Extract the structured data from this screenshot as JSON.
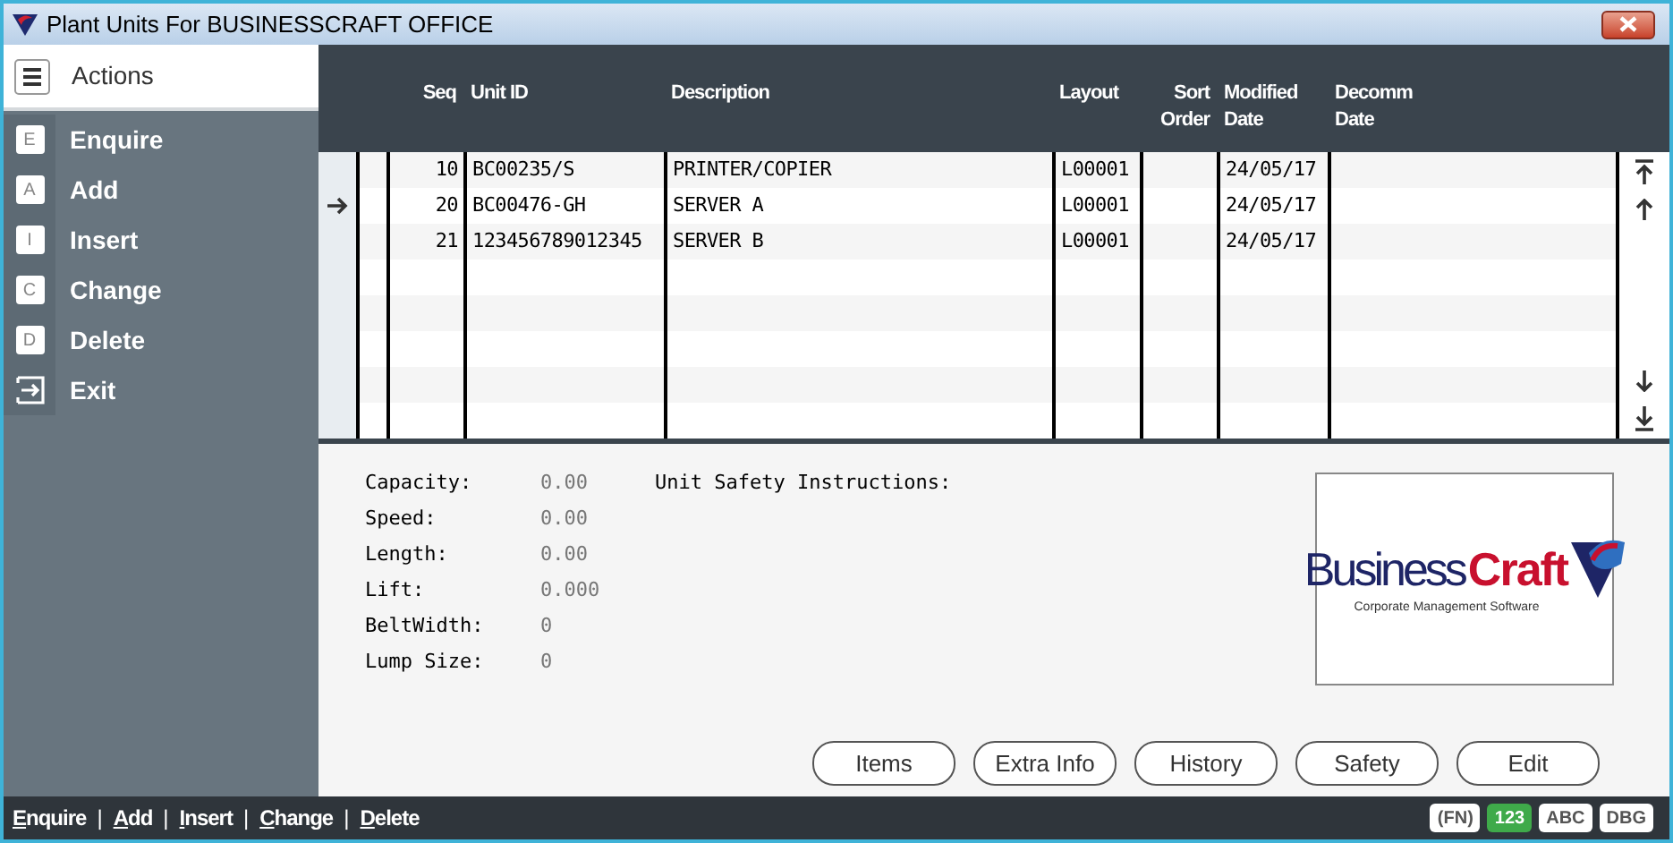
{
  "window": {
    "title": "Plant Units For BUSINESSCRAFT OFFICE"
  },
  "sidebar": {
    "title": "Actions",
    "items": [
      {
        "kind": "key",
        "key": "E",
        "label": "Enquire"
      },
      {
        "kind": "key",
        "key": "A",
        "label": "Add"
      },
      {
        "kind": "key",
        "key": "I",
        "label": "Insert"
      },
      {
        "kind": "key",
        "key": "C",
        "label": "Change"
      },
      {
        "kind": "key",
        "key": "D",
        "label": "Delete"
      },
      {
        "kind": "exit",
        "label": "Exit"
      }
    ]
  },
  "table": {
    "columns": [
      {
        "label": "Seq"
      },
      {
        "label": "Unit ID"
      },
      {
        "label": "Description"
      },
      {
        "label": "Layout"
      },
      {
        "label": "Sort Order"
      },
      {
        "label": "Modified Date"
      },
      {
        "label": "Decomm Date"
      }
    ],
    "rows": [
      {
        "selected": false,
        "cells": [
          "10",
          "BC00235/S",
          "PRINTER/COPIER",
          "L00001",
          "",
          "24/05/17",
          ""
        ]
      },
      {
        "selected": true,
        "cells": [
          "20",
          "BC00476-GH",
          "SERVER A",
          "L00001",
          "",
          "24/05/17",
          ""
        ]
      },
      {
        "selected": false,
        "cells": [
          "21",
          "123456789012345",
          "SERVER B",
          "L00001",
          "",
          "24/05/17",
          ""
        ]
      }
    ]
  },
  "details": {
    "fields": [
      {
        "label": "Capacity:",
        "value": "0.00"
      },
      {
        "label": "Speed:",
        "value": "0.00"
      },
      {
        "label": "Length:",
        "value": "0.00"
      },
      {
        "label": "Lift:",
        "value": "0.000"
      },
      {
        "label": "BeltWidth:",
        "value": "0"
      },
      {
        "label": "Lump Size:",
        "value": "0"
      }
    ],
    "safety_label": "Unit Safety Instructions:",
    "logo": {
      "brand_part_1": "Business",
      "brand_part_2": "Craft",
      "tagline": "Corporate Management Software"
    }
  },
  "buttons": [
    "Items",
    "Extra Info",
    "History",
    "Safety",
    "Edit"
  ],
  "status_bar": {
    "links": [
      "Enquire",
      "Add",
      "Insert",
      "Change",
      "Delete"
    ],
    "separators": [
      "|",
      "|",
      "|",
      "|"
    ],
    "indicators": [
      {
        "label": "(FN)",
        "on": false
      },
      {
        "label": "123",
        "on": true
      },
      {
        "label": "ABC",
        "on": false
      },
      {
        "label": "DBG",
        "on": false
      }
    ]
  }
}
